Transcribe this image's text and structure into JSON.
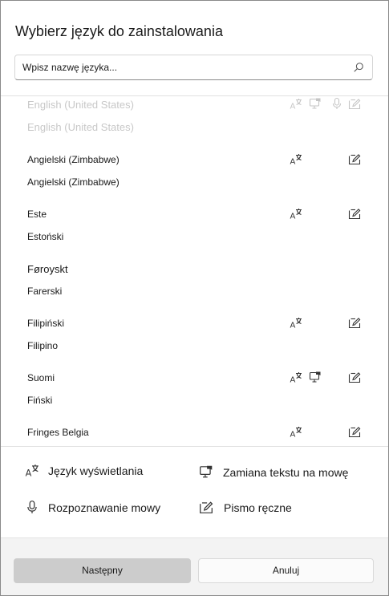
{
  "dialog": {
    "title": "Wybierz język do zainstalowania"
  },
  "search": {
    "placeholder": "Wpisz nazwę języka...",
    "icon": "search-icon"
  },
  "languages": [
    {
      "native": "English (United States)",
      "localized": "English (United States)",
      "features": [
        "display",
        "tts",
        "speech",
        "handwriting"
      ],
      "faded": true
    },
    {
      "native": "Angielski (Zimbabwe)",
      "localized": "Angielski (Zimbabwe)",
      "features": [
        "display",
        "handwriting"
      ],
      "faded": false
    },
    {
      "native": "Este",
      "localized": "Estoński",
      "features": [
        "display",
        "handwriting"
      ],
      "faded": false
    },
    {
      "native": "Føroyskt",
      "localized": "Farerski",
      "features": [],
      "faded": false
    },
    {
      "native": "Filipiński",
      "localized": "Filipino",
      "features": [
        "display",
        "handwriting"
      ],
      "faded": false
    },
    {
      "native": "Suomi",
      "localized": "Fiński",
      "features": [
        "display",
        "tts",
        "handwriting"
      ],
      "faded": false
    },
    {
      "native": "Fringes Belgia",
      "localized": "",
      "features": [
        "display",
        "handwriting"
      ],
      "faded": false
    }
  ],
  "legend": {
    "display": "Język wyświetlania",
    "tts": "Zamiana tekstu na mowę",
    "speech": "Rozpoznawanie mowy",
    "handwriting": "Pismo ręczne"
  },
  "footer": {
    "next_label": "Następny",
    "cancel_label": "Anuluj"
  }
}
